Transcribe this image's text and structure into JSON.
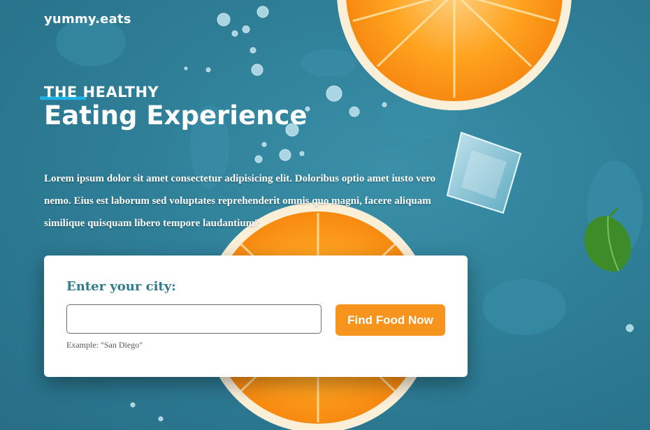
{
  "brand": {
    "name": "yummy.eats"
  },
  "hero": {
    "eyebrow": "THE HEALTHY",
    "headline": "Eating Experience",
    "intro": "Lorem ipsum dolor sit amet consectetur adipisicing elit. Doloribus optio amet iusto vero nemo. Eius est laborum sed voluptates reprehenderit omnis quo magni, facere aliquam similique quisquam libero tempore laudantium?"
  },
  "search": {
    "label": "Enter your city:",
    "value": "",
    "placeholder": "",
    "button_label": "Find Food Now",
    "helper": "Example: \"San Diego\""
  },
  "colors": {
    "background": "#2f7f98",
    "accent": "#1fb0e8",
    "button": "#f7941d",
    "label": "#2e7b8a"
  },
  "background_icons": [
    "orange-slice-icon",
    "ice-cube-icon",
    "mint-leaf-icon",
    "water-droplet-icon"
  ]
}
